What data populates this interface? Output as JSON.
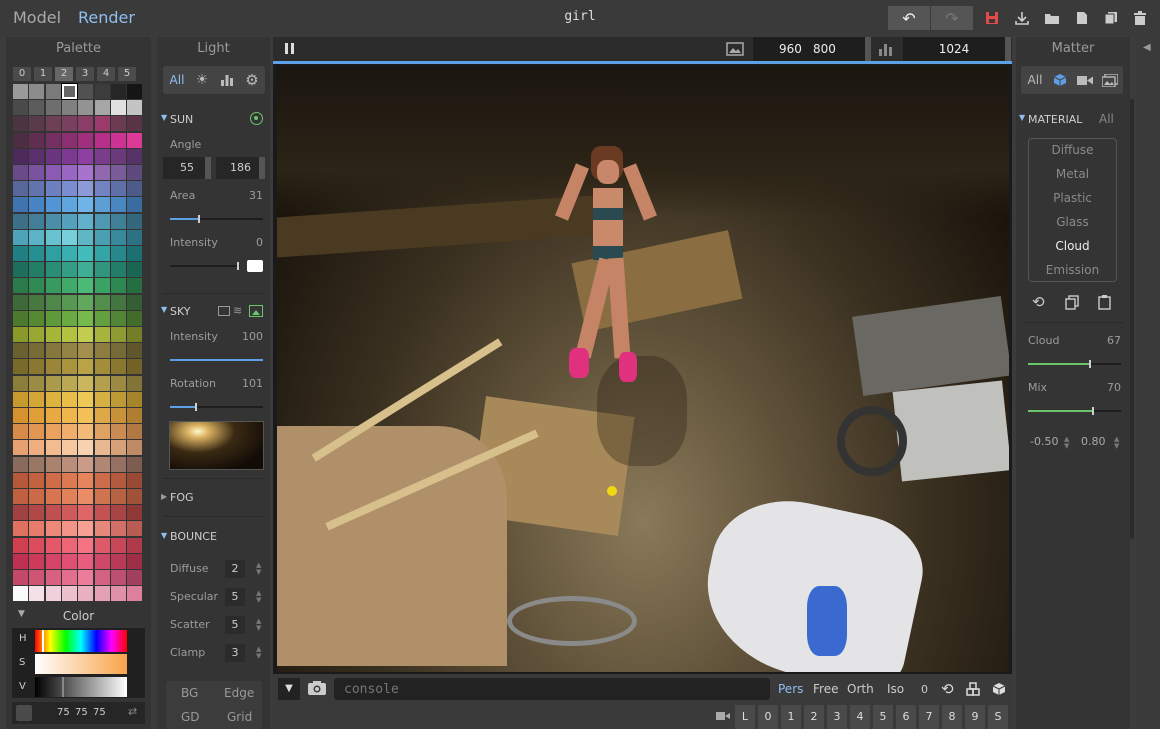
{
  "app": {
    "mode_tabs": [
      "Model",
      "Render"
    ],
    "title": "girl"
  },
  "palette": {
    "heading": "Palette",
    "tabs": [
      "0",
      "1",
      "2",
      "3",
      "4",
      "5"
    ],
    "rows": [
      [
        "#9a9a9a",
        "#8c8c8c",
        "#7a7a7a",
        "#666666",
        "#515151",
        "#3c3c3c",
        "#262626",
        "#151515"
      ],
      [
        "#4a4a4a",
        "#5c5c5c",
        "#6e6e6e",
        "#808080",
        "#939393",
        "#a6a6a6",
        "#e0e0e0",
        "#c4c4c4"
      ],
      [
        "#4a3540",
        "#5a3b4a",
        "#6e3f55",
        "#7b4060",
        "#8a3d66",
        "#9b3b6c",
        "#6b3b52",
        "#5a3344"
      ],
      [
        "#4d2d42",
        "#612e52",
        "#762f62",
        "#8b2f70",
        "#a02f7e",
        "#b82f8a",
        "#cc3394",
        "#dd3a98"
      ],
      [
        "#4c2a5c",
        "#5b2f6e",
        "#6b3480",
        "#7c3a92",
        "#8e40a2",
        "#7a3d8c",
        "#6a3a7a",
        "#563266"
      ],
      [
        "#6a4b8a",
        "#7a52a0",
        "#8a5ab5",
        "#9a66c4",
        "#a872cf",
        "#9068b0",
        "#7a5c9a",
        "#5f4a7e"
      ],
      [
        "#58679a",
        "#6373ad",
        "#6f80c0",
        "#7b8dd0",
        "#8c9ad8",
        "#7382c0",
        "#5f70a8",
        "#4d5b88"
      ],
      [
        "#3f74b0",
        "#4784c4",
        "#5295d4",
        "#5fa6df",
        "#6fb4e6",
        "#5d9fd4",
        "#4a86c0",
        "#3a6ca0"
      ],
      [
        "#3d6f86",
        "#437e98",
        "#4a8eaa",
        "#55a0bd",
        "#62b1cc",
        "#4f98b2",
        "#3f8098",
        "#33677c"
      ],
      [
        "#4ea3b8",
        "#5ab3c6",
        "#67c2d2",
        "#77cfdb",
        "#5fb6c6",
        "#4a9fb2",
        "#39899c",
        "#2c7184"
      ],
      [
        "#207f82",
        "#268f92",
        "#2e9fa2",
        "#38afb0",
        "#45bcbc",
        "#34a4a6",
        "#27898c",
        "#1d7072"
      ],
      [
        "#1d6e5a",
        "#237e68",
        "#2a8e76",
        "#339e85",
        "#3eae94",
        "#30967e",
        "#247d68",
        "#1b6554"
      ],
      [
        "#2a7a4a",
        "#308a54",
        "#379a5e",
        "#40aa6a",
        "#4aba76",
        "#3aa264",
        "#2e8852",
        "#246e42"
      ],
      [
        "#3e6a3a",
        "#467840",
        "#4e8848",
        "#579852",
        "#62a85c",
        "#528f4c",
        "#437640",
        "#365e34"
      ],
      [
        "#4b7a2e",
        "#558a33",
        "#5f9a3a",
        "#6aaa42",
        "#76ba4c",
        "#64a040",
        "#528636",
        "#426c2c"
      ],
      [
        "#8a9a2a",
        "#98a830",
        "#a6b638",
        "#b4c242",
        "#c2cc4e",
        "#a8b43e",
        "#8e9a32",
        "#747e28"
      ],
      [
        "#6a6030",
        "#786c36",
        "#86783c",
        "#948444",
        "#a2904c",
        "#8c7c40",
        "#766a36",
        "#60562c"
      ],
      [
        "#7a6a2a",
        "#8a7830",
        "#9a8636",
        "#aa943e",
        "#baa246",
        "#a28e3a",
        "#8a7830",
        "#726228"
      ],
      [
        "#8a7e3a",
        "#9a8c42",
        "#aa9a4a",
        "#baa852",
        "#cab65c",
        "#b2a04e",
        "#9a8a42",
        "#827436"
      ],
      [
        "#c89a2e",
        "#d4a636",
        "#deb23e",
        "#e8be48",
        "#eec854",
        "#d6b042",
        "#be9a36",
        "#a6842c"
      ],
      [
        "#d6922e",
        "#e09e36",
        "#e8aa40",
        "#f0b64c",
        "#f4c05a",
        "#dea846",
        "#c8923a",
        "#b07e30"
      ],
      [
        "#d88a48",
        "#e29652",
        "#eaa25e",
        "#f0ae6a",
        "#f4ba78",
        "#e0a262",
        "#ca8c52",
        "#b27844"
      ],
      [
        "#e8a070",
        "#eeae80",
        "#f2bc90",
        "#f6c8a0",
        "#f8d2ae",
        "#e8b890",
        "#d6a078",
        "#c08a64"
      ],
      [
        "#8a6a5a",
        "#9a7664",
        "#aa826e",
        "#ba8e7a",
        "#ca9c88",
        "#b08674",
        "#967062",
        "#7e5c50"
      ],
      [
        "#b8583a",
        "#c46240",
        "#d06c48",
        "#dc7852",
        "#e6845c",
        "#cc6c4a",
        "#b45a3e",
        "#9a4a34"
      ],
      [
        "#c06040",
        "#cc6a48",
        "#d87450",
        "#e2805a",
        "#ea8c66",
        "#d07450",
        "#b86244",
        "#a05238"
      ],
      [
        "#a04040",
        "#b04848",
        "#c05050",
        "#d05a5a",
        "#de6666",
        "#c45252",
        "#a84444",
        "#8e3838"
      ],
      [
        "#e07060",
        "#e87c6c",
        "#ee8878",
        "#f49486",
        "#f8a094",
        "#e6887a",
        "#d07066",
        "#b85c54"
      ],
      [
        "#d04050",
        "#dc4c5c",
        "#e65868",
        "#ee6676",
        "#f47484",
        "#de5a6a",
        "#c64858",
        "#ae3a4a"
      ],
      [
        "#c03050",
        "#cc3a5c",
        "#d64468",
        "#e05074",
        "#e85c80",
        "#d04868",
        "#b83a58",
        "#9e2e48"
      ],
      [
        "#c44868",
        "#d05474",
        "#da6080",
        "#e46e8e",
        "#ec7c9a",
        "#d46282",
        "#bc5070",
        "#a2405e"
      ],
      [
        "#fafafa",
        "#f4e0e6",
        "#f0d0da",
        "#ecc0cc",
        "#e8b0c0",
        "#e4a0b4",
        "#e090a8",
        "#dc809c"
      ]
    ],
    "selected_row": 0,
    "selected_col": 3
  },
  "color": {
    "heading": "Color",
    "channels": [
      "H",
      "S",
      "V"
    ],
    "r": "75",
    "g": "75",
    "b": "75"
  },
  "light": {
    "heading": "Light",
    "filter_all": "All",
    "sun": {
      "label": "SUN",
      "angle_label": "Angle",
      "angle_a": "55",
      "angle_b": "186",
      "area_label": "Area",
      "area_value": "31",
      "intensity_label": "Intensity",
      "intensity_value": "0"
    },
    "sky": {
      "label": "SKY",
      "intensity_label": "Intensity",
      "intensity_value": "100",
      "rotation_label": "Rotation",
      "rotation_value": "101"
    },
    "fog": {
      "label": "FOG"
    },
    "bounce": {
      "label": "BOUNCE",
      "items": [
        {
          "label": "Diffuse",
          "value": "2"
        },
        {
          "label": "Specular",
          "value": "5"
        },
        {
          "label": "Scatter",
          "value": "5"
        },
        {
          "label": "Clamp",
          "value": "3"
        }
      ]
    },
    "view_buttons": [
      "BG",
      "Edge",
      "GD",
      "Grid"
    ]
  },
  "viewport": {
    "width": "960",
    "height": "800",
    "samples": "1024",
    "console_placeholder": "console",
    "view_modes": [
      "Pers",
      "Free",
      "Orth",
      "Iso"
    ],
    "zero": "0",
    "layers": [
      "L",
      "0",
      "1",
      "2",
      "3",
      "4",
      "5",
      "6",
      "7",
      "8",
      "9",
      "S"
    ]
  },
  "matter": {
    "heading": "Matter",
    "filter_all": "All",
    "material_label": "MATERIAL",
    "material_all": "All",
    "materials": [
      "Diffuse",
      "Metal",
      "Plastic",
      "Glass",
      "Cloud",
      "Emission"
    ],
    "selected": "Cloud",
    "cloud_label": "Cloud",
    "cloud_value": "67",
    "mix_label": "Mix",
    "mix_value": "70",
    "range_a": "-0.50",
    "range_b": "0.80"
  },
  "colors": {
    "accent": "#5ea0e6",
    "save": "#e04a4a",
    "green": "#6cc46c"
  }
}
